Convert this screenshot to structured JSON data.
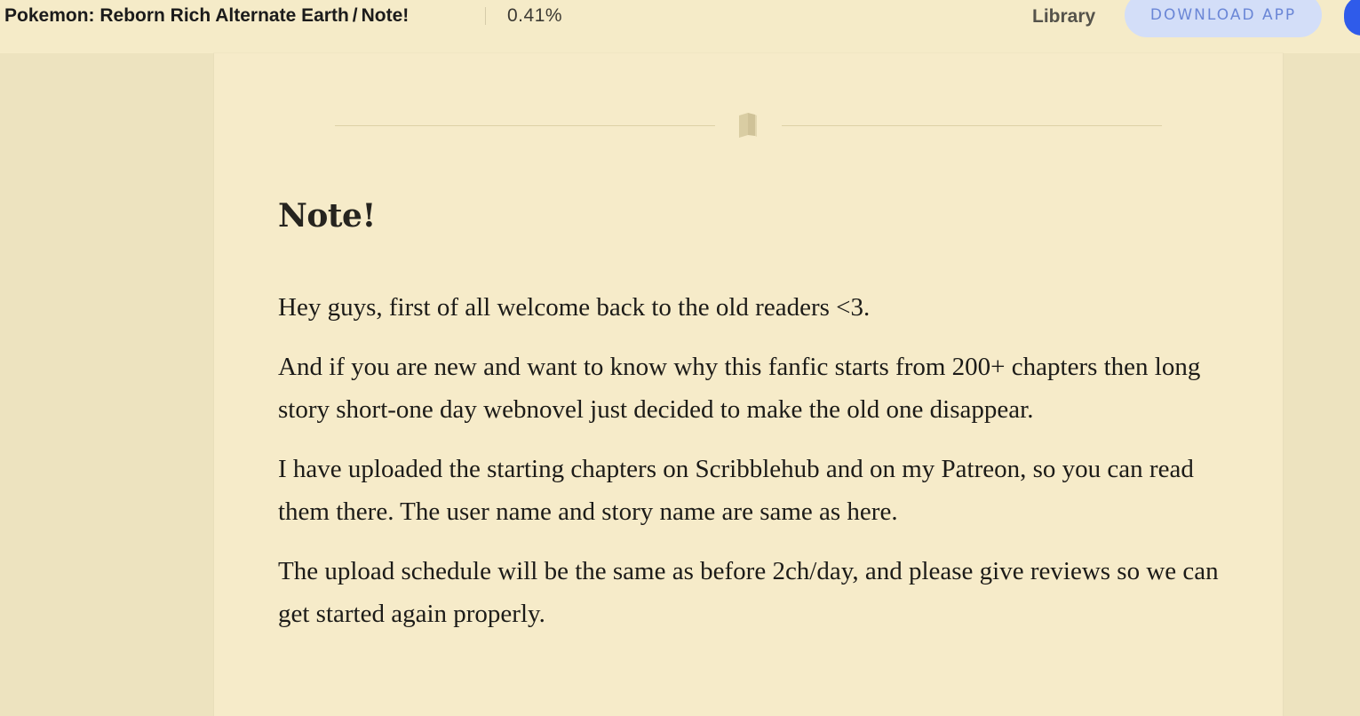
{
  "header": {
    "book_title": "Pokemon: Reborn Rich Alternate Earth",
    "separator": "/",
    "chapter_crumb": "Note!",
    "progress": "0.41%",
    "library_label": "Library",
    "download_label": "DOWNLOAD APP"
  },
  "chapter": {
    "divider_icon": "book-icon",
    "title": "Note!",
    "paragraphs": [
      "Hey guys, first of all welcome back to the old readers <3.",
      "And if you are new and want to know why this fanfic starts from 200+ chapters then long story short-one day webnovel just decided to make the old one disappear.",
      "I have uploaded the starting chapters on Scribblehub and on my Patreon, so you can read them there. The user name and story name are same as here.",
      "The upload schedule will be the same as before 2ch/day, and please give reviews so we can get started again properly."
    ]
  },
  "colors": {
    "page_background": "#ede3bf",
    "paper": "#f6ebc9",
    "header_background": "#f5ebc8",
    "download_button_bg": "#d3def8",
    "download_button_text": "#6a86d6",
    "avatar": "#2f5bea",
    "text": "#1c1b18"
  }
}
